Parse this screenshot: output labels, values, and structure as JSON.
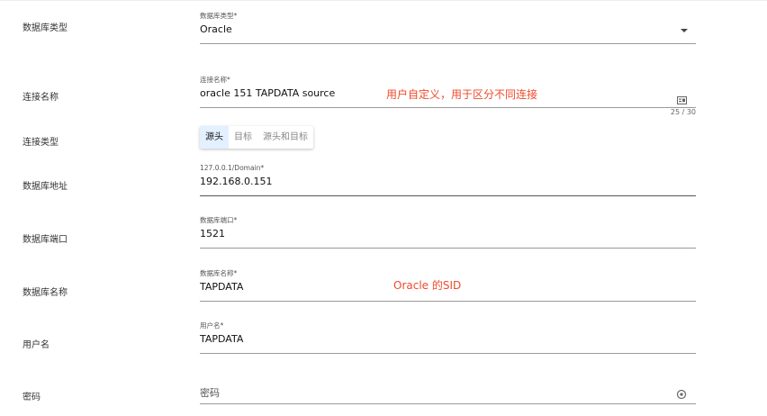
{
  "form": {
    "rows": {
      "db_type": {
        "label": "数据库类型",
        "float_label": "数据库类型*",
        "value": "Oracle"
      },
      "conn_name": {
        "label": "连接名称",
        "float_label": "连接名称*",
        "value": "oracle 151 TAPDATA source",
        "counter": "25 / 30"
      },
      "conn_type": {
        "label": "连接类型",
        "options": [
          "源头",
          "目标",
          "源头和目标"
        ],
        "selected": "源头"
      },
      "db_host": {
        "label": "数据库地址",
        "float_label": "127.0.0.1/Domain*",
        "value": "192.168.0.151"
      },
      "db_port": {
        "label": "数据库端口",
        "float_label": "数据库端口*",
        "value": "1521"
      },
      "db_name": {
        "label": "数据库名称",
        "float_label": "数据库名称*",
        "value": "TAPDATA"
      },
      "username": {
        "label": "用户名",
        "float_label": "用户名*",
        "value": "TAPDATA"
      },
      "password": {
        "label": "密码",
        "placeholder": "密码"
      }
    }
  },
  "annotations": {
    "conn_name_note": "用户自定义，用于区分不同连接",
    "db_name_note": "Oracle 的SID"
  },
  "icons": {
    "dropdown": "chevron-down-icon",
    "conn_name_field": "id-card-icon",
    "password_field": "eye-icon"
  },
  "colors": {
    "annotation": "#f04a2a",
    "segment_active_bg": "#e3f0ff"
  }
}
